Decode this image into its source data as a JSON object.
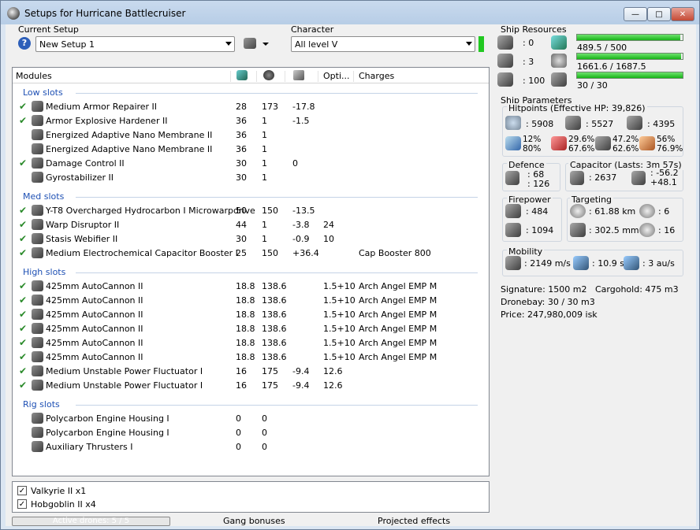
{
  "window": {
    "title": "Setups for Hurricane Battlecruiser"
  },
  "setup": {
    "label": "Current Setup",
    "value": "New Setup 1"
  },
  "character": {
    "label": "Character",
    "value": "All level V"
  },
  "modules": {
    "header": [
      "Modules",
      "Opti...",
      "Charges"
    ],
    "sections": [
      {
        "title": "Low slots",
        "rows": [
          {
            "name": "Medium Armor Repairer II",
            "c1": "28",
            "c2": "173",
            "c3": "-17.8",
            "c4": "",
            "c5": "",
            "on": true
          },
          {
            "name": "Armor Explosive Hardener II",
            "c1": "36",
            "c2": "1",
            "c3": "-1.5",
            "c4": "",
            "c5": "",
            "on": true
          },
          {
            "name": "Energized Adaptive Nano Membrane II",
            "c1": "36",
            "c2": "1",
            "c3": "",
            "c4": "",
            "c5": "",
            "on": false
          },
          {
            "name": "Energized Adaptive Nano Membrane II",
            "c1": "36",
            "c2": "1",
            "c3": "",
            "c4": "",
            "c5": "",
            "on": false
          },
          {
            "name": "Damage Control II",
            "c1": "30",
            "c2": "1",
            "c3": "0",
            "c4": "",
            "c5": "",
            "on": true
          },
          {
            "name": "Gyrostabilizer II",
            "c1": "30",
            "c2": "1",
            "c3": "",
            "c4": "",
            "c5": "",
            "on": false
          }
        ]
      },
      {
        "title": "Med slots",
        "rows": [
          {
            "name": "Y-T8 Overcharged Hydrocarbon I Microwarpdrive",
            "c1": "50",
            "c2": "150",
            "c3": "-13.5",
            "c4": "",
            "c5": "",
            "on": true
          },
          {
            "name": "Warp Disruptor II",
            "c1": "44",
            "c2": "1",
            "c3": "-3.8",
            "c4": "24",
            "c5": "",
            "on": true
          },
          {
            "name": "Stasis Webifier II",
            "c1": "30",
            "c2": "1",
            "c3": "-0.9",
            "c4": "10",
            "c5": "",
            "on": true
          },
          {
            "name": "Medium Electrochemical Capacitor Booster I",
            "c1": "25",
            "c2": "150",
            "c3": "+36.4",
            "c4": "",
            "c5": "Cap Booster 800",
            "on": true
          }
        ]
      },
      {
        "title": "High slots",
        "rows": [
          {
            "name": "425mm AutoCannon II",
            "c1": "18.8",
            "c2": "138.6",
            "c3": "",
            "c4": "1.5+10",
            "c5": "Arch Angel EMP M",
            "on": true
          },
          {
            "name": "425mm AutoCannon II",
            "c1": "18.8",
            "c2": "138.6",
            "c3": "",
            "c4": "1.5+10",
            "c5": "Arch Angel EMP M",
            "on": true
          },
          {
            "name": "425mm AutoCannon II",
            "c1": "18.8",
            "c2": "138.6",
            "c3": "",
            "c4": "1.5+10",
            "c5": "Arch Angel EMP M",
            "on": true
          },
          {
            "name": "425mm AutoCannon II",
            "c1": "18.8",
            "c2": "138.6",
            "c3": "",
            "c4": "1.5+10",
            "c5": "Arch Angel EMP M",
            "on": true
          },
          {
            "name": "425mm AutoCannon II",
            "c1": "18.8",
            "c2": "138.6",
            "c3": "",
            "c4": "1.5+10",
            "c5": "Arch Angel EMP M",
            "on": true
          },
          {
            "name": "425mm AutoCannon II",
            "c1": "18.8",
            "c2": "138.6",
            "c3": "",
            "c4": "1.5+10",
            "c5": "Arch Angel EMP M",
            "on": true
          },
          {
            "name": "Medium Unstable Power Fluctuator I",
            "c1": "16",
            "c2": "175",
            "c3": "-9.4",
            "c4": "12.6",
            "c5": "",
            "on": true
          },
          {
            "name": "Medium Unstable Power Fluctuator I",
            "c1": "16",
            "c2": "175",
            "c3": "-9.4",
            "c4": "12.6",
            "c5": "",
            "on": true
          }
        ]
      },
      {
        "title": "Rig slots",
        "rows": [
          {
            "name": "Polycarbon Engine Housing I",
            "c1": "0",
            "c2": "0",
            "c3": "",
            "c4": "",
            "c5": "",
            "on": false
          },
          {
            "name": "Polycarbon Engine Housing I",
            "c1": "0",
            "c2": "0",
            "c3": "",
            "c4": "",
            "c5": "",
            "on": false
          },
          {
            "name": "Auxiliary Thrusters I",
            "c1": "0",
            "c2": "0",
            "c3": "",
            "c4": "",
            "c5": "",
            "on": false
          }
        ]
      }
    ]
  },
  "drones": [
    {
      "label": "Valkyrie II x1",
      "checked": true
    },
    {
      "label": "Hobgoblin II x4",
      "checked": true
    }
  ],
  "footer": {
    "active_drones": "Active drones: 5 / 5",
    "gang": "Gang bonuses",
    "projected": "Projected effects"
  },
  "resources": {
    "title": "Ship Resources",
    "hi": ": 0",
    "med": ": 3",
    "launch": ": 100",
    "cpu": "489.5 / 500",
    "cpu_frac": 0.979,
    "pg": "1661.6 / 1687.5",
    "pg_frac": 0.985,
    "bw": "30 / 30",
    "bw_frac": 1.0
  },
  "params": {
    "title": "Ship Parameters",
    "hp": "Hitpoints (Effective HP: 39,826)",
    "shield": ": 5908",
    "armor": ": 5527",
    "hull": ": 4395",
    "em": [
      "12%",
      "80%"
    ],
    "th": [
      "29.6%",
      "67.6%"
    ],
    "ki": [
      "47.2%",
      "62.6%"
    ],
    "ex": [
      "56%",
      "76.9%"
    ],
    "defence": "Defence",
    "def1": ": 68",
    "def2": ": 126",
    "cap": "Capacitor (Lasts: 3m 57s)",
    "cap_amt": ": 2637",
    "cap_a": ": -56.2",
    "cap_b": "+48.1",
    "fp": "Firepower",
    "fp1": ": 484",
    "fp2": ": 1094",
    "tg": "Targeting",
    "tg_range": ": 61.88 km",
    "tg_targets": ": 6",
    "tg_res": ": 302.5 mm",
    "tg_sens": ": 16",
    "mob": "Mobility",
    "speed": ": 2149 m/s",
    "align": ": 10.9 s",
    "warp": ": 3 au/s",
    "sig": "Signature: 1500 m2",
    "cargo": "Cargohold: 475 m3",
    "dronebay": "Dronebay: 30 / 30 m3",
    "price": "Price: 247,980,009 isk"
  }
}
